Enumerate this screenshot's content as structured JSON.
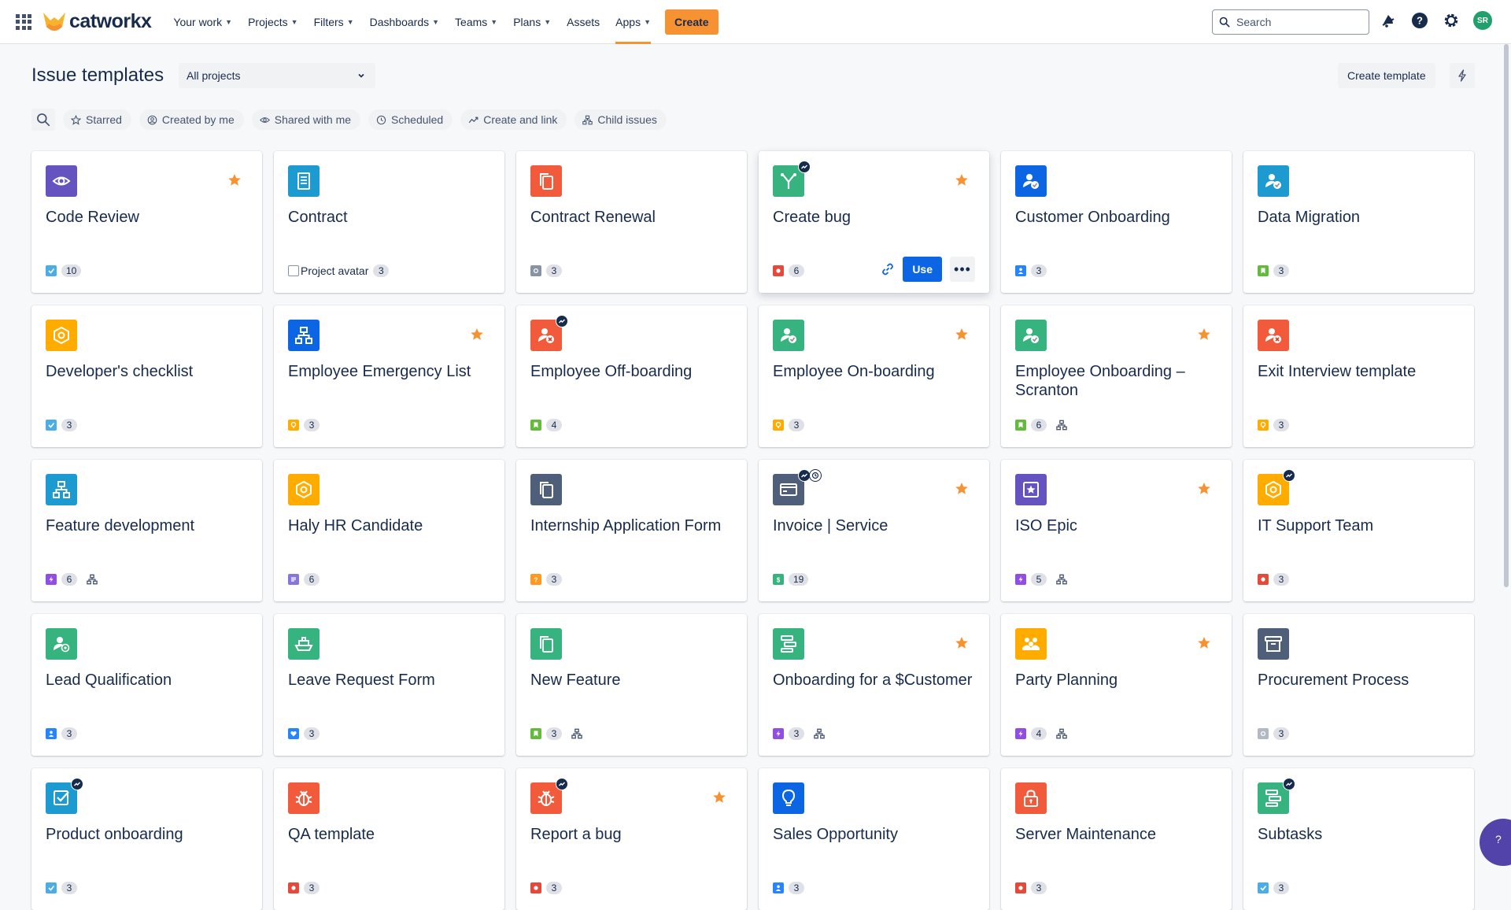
{
  "nav": {
    "brand": "catworkx",
    "items": [
      {
        "label": "Your work",
        "dropdown": true
      },
      {
        "label": "Projects",
        "dropdown": true
      },
      {
        "label": "Filters",
        "dropdown": true
      },
      {
        "label": "Dashboards",
        "dropdown": true
      },
      {
        "label": "Teams",
        "dropdown": true
      },
      {
        "label": "Plans",
        "dropdown": true
      },
      {
        "label": "Assets",
        "dropdown": false
      },
      {
        "label": "Apps",
        "dropdown": true,
        "active": true
      }
    ],
    "create_label": "Create",
    "search_placeholder": "Search",
    "avatar_initials": "SR"
  },
  "header": {
    "title": "Issue templates",
    "project_filter": "All projects",
    "create_template_label": "Create template"
  },
  "filters": [
    "Starred",
    "Created by me",
    "Shared with me",
    "Scheduled",
    "Create and link",
    "Child issues"
  ],
  "templates": [
    {
      "title": "Code Review",
      "icon": "eye-icon",
      "bg": "#6554c0",
      "starred": true,
      "type": "task",
      "count": "10"
    },
    {
      "title": "Contract",
      "icon": "document-icon",
      "bg": "#1d9bd1",
      "starred": false,
      "type": "avatar",
      "avatar_alt": "Project avatar",
      "count": "3"
    },
    {
      "title": "Contract Renewal",
      "icon": "copy-icon",
      "bg": "#f15b3c",
      "starred": false,
      "type": "gray",
      "count": "3"
    },
    {
      "title": "Create bug",
      "icon": "fork-icon",
      "bg": "#36b37e",
      "starred": true,
      "automation": true,
      "type": "bug",
      "count": "6",
      "hovered": true,
      "use_label": "Use"
    },
    {
      "title": "Customer Onboarding",
      "icon": "user-check-icon",
      "bg": "#0c66e4",
      "starred": false,
      "type": "user",
      "count": "3"
    },
    {
      "title": "Data Migration",
      "icon": "user-check-icon",
      "bg": "#1d9bd1",
      "starred": false,
      "type": "story",
      "count": "3"
    },
    {
      "title": "Developer's checklist",
      "icon": "hexagon-icon",
      "bg": "#ffab00",
      "starred": false,
      "type": "task",
      "count": "3"
    },
    {
      "title": "Employee Emergency List",
      "icon": "hierarchy-icon",
      "bg": "#0c66e4",
      "starred": true,
      "type": "idea",
      "count": "3"
    },
    {
      "title": "Employee Off-boarding",
      "icon": "user-x-icon",
      "bg": "#f15b3c",
      "starred": false,
      "automation": true,
      "type": "story",
      "count": "4"
    },
    {
      "title": "Employee On-boarding",
      "icon": "user-check-icon",
      "bg": "#36b37e",
      "starred": true,
      "type": "idea",
      "count": "3"
    },
    {
      "title": "Employee Onboarding – Scranton",
      "icon": "user-check-icon",
      "bg": "#36b37e",
      "starred": true,
      "type": "story",
      "count": "6",
      "child": true
    },
    {
      "title": "Exit Interview template",
      "icon": "user-x-icon",
      "bg": "#f15b3c",
      "starred": false,
      "type": "idea",
      "count": "3"
    },
    {
      "title": "Feature development",
      "icon": "hierarchy-icon",
      "bg": "#1d9bd1",
      "starred": false,
      "type": "epic",
      "count": "6",
      "child": true
    },
    {
      "title": "Haly HR Candidate",
      "icon": "hexagon-icon",
      "bg": "#ffab00",
      "starred": false,
      "type": "note",
      "count": "6"
    },
    {
      "title": "Internship Application Form",
      "icon": "copy-icon",
      "bg": "#505f79",
      "starred": false,
      "type": "question",
      "count": "3"
    },
    {
      "title": "Invoice | Service",
      "icon": "card-icon",
      "bg": "#505f79",
      "starred": true,
      "automation": true,
      "scheduled": true,
      "type": "dollar",
      "count": "19"
    },
    {
      "title": "ISO Epic",
      "icon": "star-frame-icon",
      "bg": "#6554c0",
      "starred": true,
      "type": "epic",
      "count": "5",
      "child": true
    },
    {
      "title": "IT Support Team",
      "icon": "hexagon-icon",
      "bg": "#ffab00",
      "starred": false,
      "automation": true,
      "type": "bug",
      "count": "3"
    },
    {
      "title": "Lead Qualification",
      "icon": "user-at-icon",
      "bg": "#36b37e",
      "starred": false,
      "type": "user",
      "count": "3"
    },
    {
      "title": "Leave Request Form",
      "icon": "ship-icon",
      "bg": "#36b37e",
      "starred": false,
      "type": "heart",
      "count": "3"
    },
    {
      "title": "New Feature",
      "icon": "copy-icon",
      "bg": "#36b37e",
      "starred": false,
      "type": "story",
      "count": "3",
      "child": true
    },
    {
      "title": "Onboarding for a $Customer",
      "icon": "stack-icon",
      "bg": "#36b37e",
      "starred": true,
      "type": "epic",
      "count": "3",
      "child": true
    },
    {
      "title": "Party Planning",
      "icon": "people-icon",
      "bg": "#ffab00",
      "starred": true,
      "type": "epic",
      "count": "4",
      "child": true
    },
    {
      "title": "Procurement Process",
      "icon": "archive-icon",
      "bg": "#505f79",
      "starred": false,
      "type": "gray-light",
      "count": "3"
    },
    {
      "title": "Product onboarding",
      "icon": "checkbox-icon",
      "bg": "#1d9bd1",
      "starred": false,
      "automation": true,
      "type": "task",
      "count": "3"
    },
    {
      "title": "QA template",
      "icon": "bug-icon",
      "bg": "#f15b3c",
      "starred": false,
      "type": "bug",
      "count": "3"
    },
    {
      "title": "Report a bug",
      "icon": "bug-icon",
      "bg": "#f15b3c",
      "starred": true,
      "automation": true,
      "type": "bug",
      "count": "3"
    },
    {
      "title": "Sales Opportunity",
      "icon": "bulb-icon",
      "bg": "#0c66e4",
      "starred": false,
      "type": "user",
      "count": "3"
    },
    {
      "title": "Server Maintenance",
      "icon": "lock-icon",
      "bg": "#f15b3c",
      "starred": false,
      "type": "bug",
      "count": "3"
    },
    {
      "title": "Subtasks",
      "icon": "stack-icon",
      "bg": "#36b37e",
      "starred": false,
      "automation": true,
      "type": "task",
      "count": "3"
    }
  ],
  "help_label": "?"
}
